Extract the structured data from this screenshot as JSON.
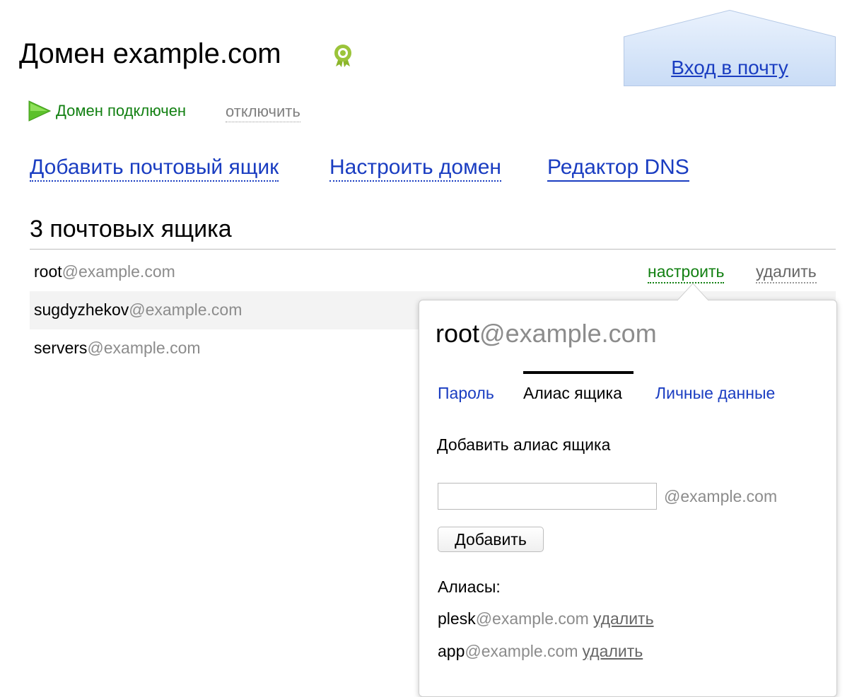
{
  "header": {
    "title": "Домен example.com",
    "badge_icon": "verified-badge-icon",
    "mail_login": "Вход в почту"
  },
  "status": {
    "text": "Домен подключен",
    "disconnect": "отключить",
    "color": "#128012"
  },
  "actions": {
    "add_mailbox": "Добавить почтовый ящик",
    "configure_domain": "Настроить домен",
    "dns_editor": "Редактор DNS"
  },
  "mailboxes": {
    "title": "3 почтовых ящика",
    "items": [
      {
        "user": "root",
        "domain": "@example.com",
        "configure": "настроить",
        "delete": "удалить"
      },
      {
        "user": "sugdyzhekov",
        "domain": "@example.com"
      },
      {
        "user": "servers",
        "domain": "@example.com"
      }
    ]
  },
  "popup": {
    "user": "root",
    "domain": "@example.com",
    "tabs": [
      {
        "label": "Пароль",
        "active": false
      },
      {
        "label": "Алиас ящика",
        "active": true
      },
      {
        "label": "Личные данные",
        "active": false
      }
    ],
    "add_alias_heading": "Добавить алиас ящика",
    "alias_input_value": "",
    "alias_domain_suffix": "@example.com",
    "add_button": "Добавить",
    "aliases_label": "Алиасы:",
    "aliases": [
      {
        "user": "plesk",
        "domain": "@example.com",
        "delete": "удалить"
      },
      {
        "user": "app",
        "domain": "@example.com",
        "delete": "удалить"
      }
    ]
  },
  "colors": {
    "link": "#1a3dc1",
    "muted": "#8c8c8c",
    "mail_button_fill": "#d7e6fa"
  }
}
